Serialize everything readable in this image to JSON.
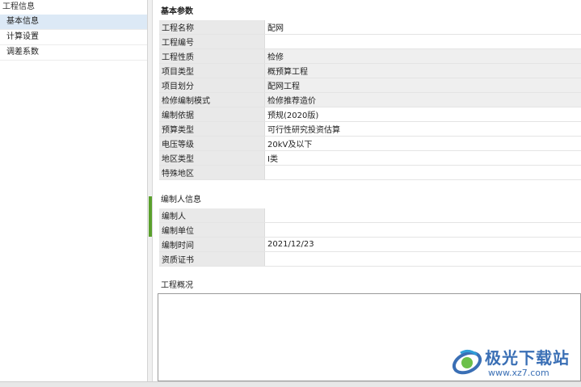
{
  "nav": {
    "header": "工程信息",
    "items": [
      {
        "label": "基本信息",
        "active": true
      },
      {
        "label": "计算设置",
        "active": false
      },
      {
        "label": "调差系数",
        "active": false
      }
    ]
  },
  "basic": {
    "title": "基本参数",
    "rows": [
      {
        "label": "工程名称",
        "value": "配网"
      },
      {
        "label": "工程编号",
        "value": ""
      },
      {
        "label": "工程性质",
        "value": "检修"
      },
      {
        "label": "项目类型",
        "value": "概预算工程"
      },
      {
        "label": "项目划分",
        "value": "配网工程"
      },
      {
        "label": "检修编制模式",
        "value": "检修推荐造价"
      },
      {
        "label": "编制依据",
        "value": "预规(2020版)"
      },
      {
        "label": "预算类型",
        "value": "可行性研究投资估算"
      },
      {
        "label": "电压等级",
        "value": "20kV及以下"
      },
      {
        "label": "地区类型",
        "value": "Ⅰ类"
      },
      {
        "label": "特殊地区",
        "value": ""
      }
    ]
  },
  "author": {
    "title": "编制人信息",
    "rows": [
      {
        "label": "编制人",
        "value": ""
      },
      {
        "label": "编制单位",
        "value": ""
      },
      {
        "label": "编制时间",
        "value": "2021/12/23"
      },
      {
        "label": "资质证书",
        "value": ""
      }
    ]
  },
  "overview": {
    "title": "工程概况",
    "value": ""
  },
  "watermark": {
    "text": "极光下载站",
    "url": "www.xz7.com"
  },
  "colors": {
    "accent_green": "#5aa02c",
    "nav_active": "#dce9f6",
    "watermark_blue": "#3a6fb5"
  }
}
